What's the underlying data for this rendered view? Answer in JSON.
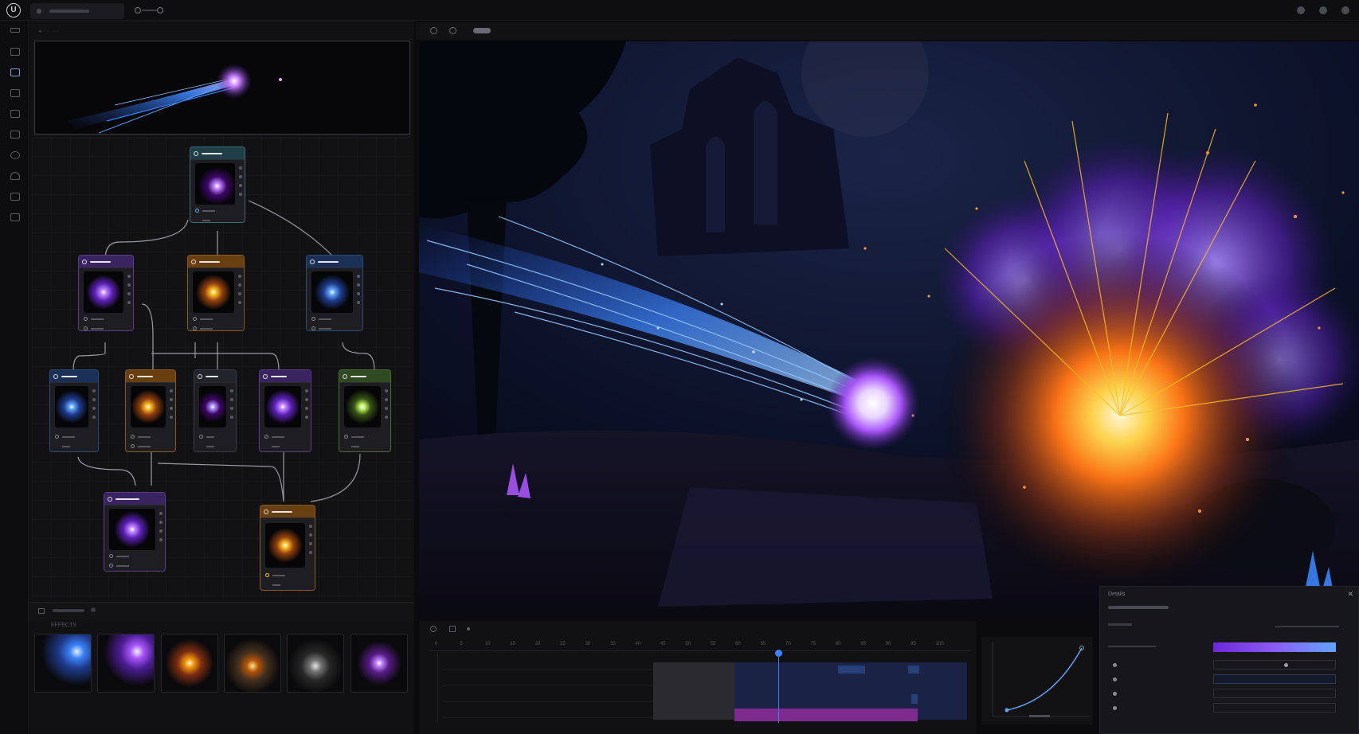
{
  "app": {
    "logo_text": "U",
    "tab_label": "▬▬▬▬▬▬"
  },
  "graph_panel": {
    "breadcrumb": "◂ ···· ····"
  },
  "library": {
    "title": "EFFECTS"
  },
  "details": {
    "header": "Details"
  },
  "timeline": {
    "tick_labels": [
      "0",
      "5",
      "10",
      "15",
      "20",
      "25",
      "30",
      "35",
      "40",
      "45",
      "50",
      "55",
      "60",
      "65",
      "70",
      "75",
      "80",
      "85",
      "90",
      "95",
      "100"
    ]
  },
  "colors": {
    "accent_purple": "#8b5cf6",
    "accent_blue": "#3b82f6",
    "accent_orange": "#f59e0b",
    "node_teal": "#1f4a55",
    "node_green": "#3a5a2a"
  },
  "icons": [
    "app-logo-icon",
    "play-icon",
    "settings-icon",
    "grid-icon",
    "particle-icon",
    "material-icon",
    "mesh-icon",
    "texture-icon",
    "sphere-icon",
    "curve-icon",
    "image-icon"
  ]
}
